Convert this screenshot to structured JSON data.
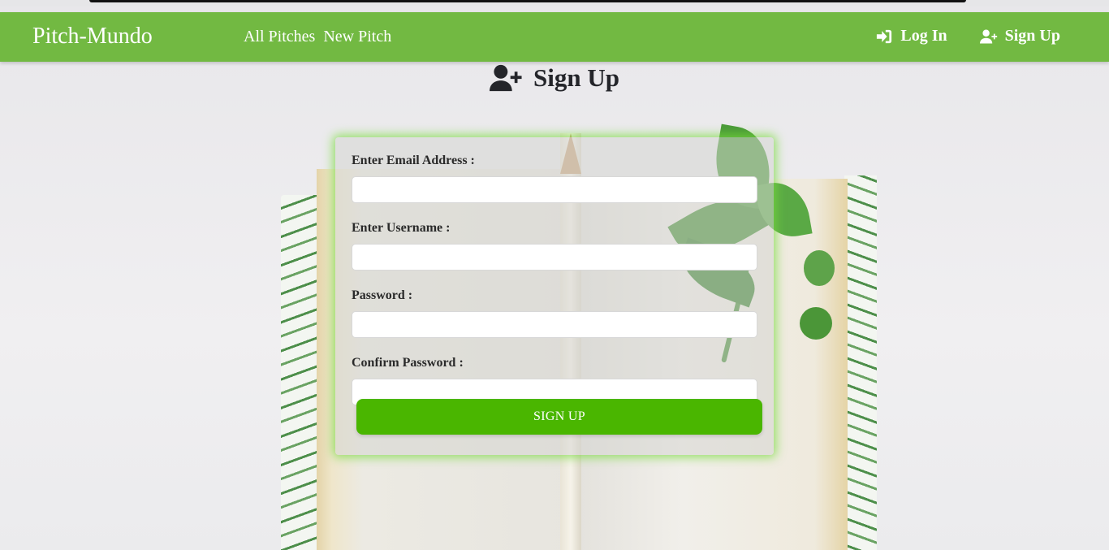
{
  "navbar": {
    "brand": "Pitch-Mundo",
    "links": [
      {
        "label": "All Pitches"
      },
      {
        "label": "New Pitch"
      }
    ],
    "login": {
      "label": "Log In",
      "icon": "sign-in-icon"
    },
    "signup": {
      "label": "Sign Up",
      "icon": "user-plus-icon"
    },
    "color": "#72b942"
  },
  "page": {
    "title": "Sign Up",
    "title_icon": "user-plus-icon"
  },
  "form": {
    "email_label": "Enter Email Address :",
    "email_value": "",
    "username_label": "Enter Username :",
    "username_value": "",
    "password_label": "Password :",
    "password_value": "",
    "confirm_label": "Confirm Password :",
    "confirm_value": "",
    "submit_label": "SIGN UP",
    "submit_color": "#4ab600",
    "glow_color": "#78dc3c"
  }
}
